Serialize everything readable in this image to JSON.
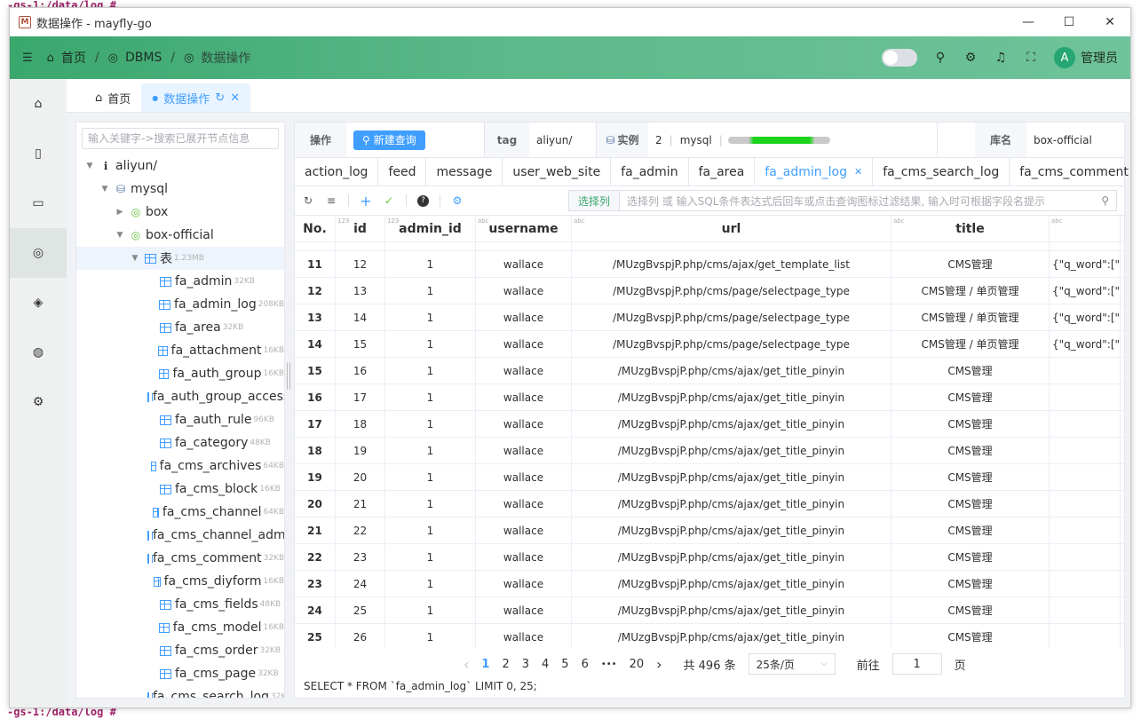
{
  "terminal": {
    "top": "-gs-1:/data/log #",
    "bottom": "-gs-1:/data/log #"
  },
  "window": {
    "title": "数据操作 - mayfly-go",
    "logo_letter": "M"
  },
  "header": {
    "crumbs": [
      "首页",
      "DBMS",
      "数据操作"
    ],
    "user": "管理员",
    "avatar": "A"
  },
  "page_tabs": [
    {
      "label": "首页"
    },
    {
      "label": "数据操作"
    }
  ],
  "tree": {
    "search_placeholder": "输入关键字->搜索已展开节点信息",
    "nodes": [
      {
        "label": "aliyun/",
        "indent": 0,
        "arrow": "▼",
        "icon": "info-icon",
        "size": ""
      },
      {
        "label": "mysql",
        "indent": 1,
        "arrow": "▼",
        "icon": "mysql-icon",
        "size": ""
      },
      {
        "label": "box",
        "indent": 2,
        "arrow": "▶",
        "icon": "database-icon",
        "size": ""
      },
      {
        "label": "box-official",
        "indent": 2,
        "arrow": "▼",
        "icon": "database-icon",
        "size": ""
      },
      {
        "label": "表",
        "indent": 3,
        "arrow": "▼",
        "icon": "table-group-icon",
        "size": "1.23MB",
        "selected": true
      },
      {
        "label": "fa_admin",
        "indent": 4,
        "icon": "table-icon",
        "size": "32KB"
      },
      {
        "label": "fa_admin_log",
        "indent": 4,
        "icon": "table-icon",
        "size": "208KB"
      },
      {
        "label": "fa_area",
        "indent": 4,
        "icon": "table-icon",
        "size": "32KB"
      },
      {
        "label": "fa_attachment",
        "indent": 4,
        "icon": "table-icon",
        "size": "16KB"
      },
      {
        "label": "fa_auth_group",
        "indent": 4,
        "icon": "table-icon",
        "size": "16KB"
      },
      {
        "label": "fa_auth_group_access",
        "indent": 4,
        "icon": "table-icon",
        "size": ""
      },
      {
        "label": "fa_auth_rule",
        "indent": 4,
        "icon": "table-icon",
        "size": "96KB"
      },
      {
        "label": "fa_category",
        "indent": 4,
        "icon": "table-icon",
        "size": "48KB"
      },
      {
        "label": "fa_cms_archives",
        "indent": 4,
        "icon": "table-icon",
        "size": "64KB"
      },
      {
        "label": "fa_cms_block",
        "indent": 4,
        "icon": "table-icon",
        "size": "16KB"
      },
      {
        "label": "fa_cms_channel",
        "indent": 4,
        "icon": "table-icon",
        "size": "64KB"
      },
      {
        "label": "fa_cms_channel_admi",
        "indent": 4,
        "icon": "table-icon",
        "size": ""
      },
      {
        "label": "fa_cms_comment",
        "indent": 4,
        "icon": "table-icon",
        "size": "32KB"
      },
      {
        "label": "fa_cms_diyform",
        "indent": 4,
        "icon": "table-icon",
        "size": "16KB"
      },
      {
        "label": "fa_cms_fields",
        "indent": 4,
        "icon": "table-icon",
        "size": "48KB"
      },
      {
        "label": "fa_cms_model",
        "indent": 4,
        "icon": "table-icon",
        "size": "16KB"
      },
      {
        "label": "fa_cms_order",
        "indent": 4,
        "icon": "table-icon",
        "size": "32KB"
      },
      {
        "label": "fa_cms_page",
        "indent": 4,
        "icon": "table-icon",
        "size": "32KB"
      },
      {
        "label": "fa_cms_search_log",
        "indent": 4,
        "icon": "table-icon",
        "size": "32KB"
      }
    ]
  },
  "info": {
    "op_label": "操作",
    "new_query": "新建查询",
    "tag_label": "tag",
    "tag_value": "aliyun/",
    "instance_label": "实例",
    "instance_id": "2",
    "instance_type": "mysql",
    "db_label": "库名",
    "db_value": "box-official"
  },
  "db_tabs": [
    "action_log",
    "feed",
    "message",
    "user_web_site",
    "fa_admin",
    "fa_area",
    "fa_admin_log",
    "fa_cms_search_log",
    "fa_cms_comment"
  ],
  "active_db_tab": "fa_admin_log",
  "filter": {
    "select_col": "选择列",
    "placeholder": "选择列 或 输入SQL条件表达式后回车或点击查询图标过滤结果, 输入时可根据字段名提示"
  },
  "columns": [
    {
      "name": "No.",
      "type": ""
    },
    {
      "name": "id",
      "type": "123"
    },
    {
      "name": "admin_id",
      "type": "123"
    },
    {
      "name": "username",
      "type": "abc"
    },
    {
      "name": "url",
      "type": "abc"
    },
    {
      "name": "title",
      "type": "abc"
    },
    {
      "name": "",
      "type": "abc"
    }
  ],
  "rows": [
    {
      "no": "11",
      "id": "12",
      "admin_id": "1",
      "username": "wallace",
      "url": "/MUzgBvspjP.php/cms/ajax/get_template_list",
      "title": "CMS管理",
      "params": "{\"q_word\":[\"\"],"
    },
    {
      "no": "12",
      "id": "13",
      "admin_id": "1",
      "username": "wallace",
      "url": "/MUzgBvspjP.php/cms/page/selectpage_type",
      "title": "CMS管理 / 单页管理",
      "params": "{\"q_word\":[\"\"],"
    },
    {
      "no": "13",
      "id": "14",
      "admin_id": "1",
      "username": "wallace",
      "url": "/MUzgBvspjP.php/cms/page/selectpage_type",
      "title": "CMS管理 / 单页管理",
      "params": "{\"q_word\":[\"\"],"
    },
    {
      "no": "14",
      "id": "15",
      "admin_id": "1",
      "username": "wallace",
      "url": "/MUzgBvspjP.php/cms/page/selectpage_type",
      "title": "CMS管理 / 单页管理",
      "params": "{\"q_word\":[\"\"],"
    },
    {
      "no": "15",
      "id": "16",
      "admin_id": "1",
      "username": "wallace",
      "url": "/MUzgBvspjP.php/cms/ajax/get_title_pinyin",
      "title": "CMS管理",
      "params": ""
    },
    {
      "no": "16",
      "id": "17",
      "admin_id": "1",
      "username": "wallace",
      "url": "/MUzgBvspjP.php/cms/ajax/get_title_pinyin",
      "title": "CMS管理",
      "params": ""
    },
    {
      "no": "17",
      "id": "18",
      "admin_id": "1",
      "username": "wallace",
      "url": "/MUzgBvspjP.php/cms/ajax/get_title_pinyin",
      "title": "CMS管理",
      "params": ""
    },
    {
      "no": "18",
      "id": "19",
      "admin_id": "1",
      "username": "wallace",
      "url": "/MUzgBvspjP.php/cms/ajax/get_title_pinyin",
      "title": "CMS管理",
      "params": ""
    },
    {
      "no": "19",
      "id": "20",
      "admin_id": "1",
      "username": "wallace",
      "url": "/MUzgBvspjP.php/cms/ajax/get_title_pinyin",
      "title": "CMS管理",
      "params": ""
    },
    {
      "no": "20",
      "id": "21",
      "admin_id": "1",
      "username": "wallace",
      "url": "/MUzgBvspjP.php/cms/ajax/get_title_pinyin",
      "title": "CMS管理",
      "params": ""
    },
    {
      "no": "21",
      "id": "22",
      "admin_id": "1",
      "username": "wallace",
      "url": "/MUzgBvspjP.php/cms/ajax/get_title_pinyin",
      "title": "CMS管理",
      "params": ""
    },
    {
      "no": "22",
      "id": "23",
      "admin_id": "1",
      "username": "wallace",
      "url": "/MUzgBvspjP.php/cms/ajax/get_title_pinyin",
      "title": "CMS管理",
      "params": ""
    },
    {
      "no": "23",
      "id": "24",
      "admin_id": "1",
      "username": "wallace",
      "url": "/MUzgBvspjP.php/cms/ajax/get_title_pinyin",
      "title": "CMS管理",
      "params": ""
    },
    {
      "no": "24",
      "id": "25",
      "admin_id": "1",
      "username": "wallace",
      "url": "/MUzgBvspjP.php/cms/ajax/get_title_pinyin",
      "title": "CMS管理",
      "params": ""
    },
    {
      "no": "25",
      "id": "26",
      "admin_id": "1",
      "username": "wallace",
      "url": "/MUzgBvspjP.php/cms/ajax/get_title_pinyin",
      "title": "CMS管理",
      "params": ""
    }
  ],
  "pager": {
    "prev": "‹",
    "pages": [
      "1",
      "2",
      "3",
      "4",
      "5",
      "6"
    ],
    "ellipsis": "•••",
    "last": "20",
    "next": "›",
    "current": "1",
    "total": "共 496 条",
    "page_size": "25条/页",
    "goto_label": "前往",
    "goto_value": "1",
    "page_unit": "页"
  },
  "sql": "SELECT * FROM `fa_admin_log` LIMIT 0, 25;",
  "colors": {
    "accent": "#409eff",
    "brand": "#3aa76d"
  }
}
